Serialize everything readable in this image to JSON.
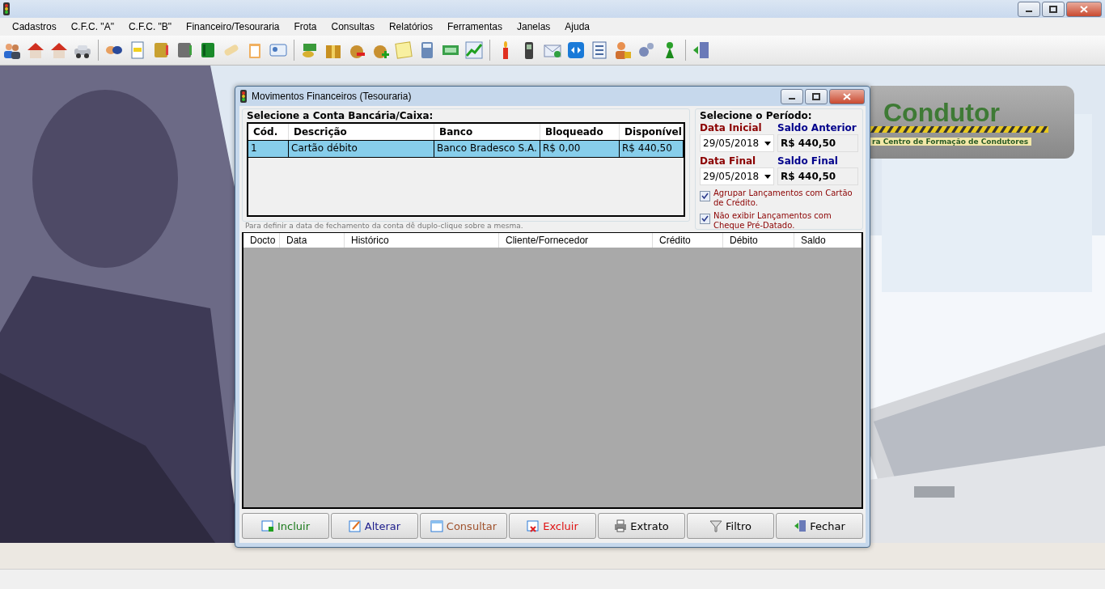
{
  "menu": [
    {
      "label": "Cadastros"
    },
    {
      "label": "C.F.C. \"A\""
    },
    {
      "label": "C.F.C. \"B\""
    },
    {
      "label": "Financeiro/Tesouraria"
    },
    {
      "label": "Frota"
    },
    {
      "label": "Consultas"
    },
    {
      "label": "Relatórios"
    },
    {
      "label": "Ferramentas"
    },
    {
      "label": "Janelas"
    },
    {
      "label": "Ajuda"
    }
  ],
  "logo": {
    "title": "Condutor",
    "subtitle": "ra Centro de Formação de Condutores"
  },
  "dialog": {
    "title": "Movimentos Financeiros (Tesouraria)",
    "accounts": {
      "title": "Selecione a Conta Bancária/Caixa:",
      "columns": [
        "Cód.",
        "Descrição",
        "Banco",
        "Bloqueado",
        "Disponível"
      ],
      "rows": [
        {
          "cells": [
            "1",
            "Cartão débito",
            "Banco Bradesco S.A.",
            "R$ 0,00",
            "R$ 440,50"
          ],
          "selected": true
        }
      ],
      "note": "Para definir a data de fechamento da conta dê duplo-clique sobre a mesma."
    },
    "period": {
      "title": "Selecione o Período:",
      "start_label": "Data Inicial",
      "start_date": "29/05/2018",
      "previous_label": "Saldo Anterior",
      "previous_balance": "R$ 440,50",
      "end_label": "Data Final",
      "end_date": "29/05/2018",
      "final_label": "Saldo Final",
      "final_balance": "R$ 440,50",
      "options": [
        {
          "label": "Agrupar Lançamentos com Cartão de Crédito.",
          "checked": true
        },
        {
          "label": "Não exibir Lançamentos com Cheque Pré-Datado.",
          "checked": true
        }
      ]
    },
    "movements": {
      "columns": [
        "Docto",
        "Data",
        "Histórico",
        "Cliente/Fornecedor",
        "Crédito",
        "Débito",
        "Saldo"
      ]
    },
    "buttons": [
      {
        "label": "Incluir",
        "kind": "add",
        "color": "#1a7a1a"
      },
      {
        "label": "Alterar",
        "kind": "edit",
        "color": "#1c1c8c"
      },
      {
        "label": "Consultar",
        "kind": "view",
        "color": "#a0522d"
      },
      {
        "label": "Excluir",
        "kind": "delete",
        "color": "#e01010"
      },
      {
        "label": "Extrato",
        "kind": "print",
        "color": "#000000"
      },
      {
        "label": "Filtro",
        "kind": "filter",
        "color": "#000000"
      },
      {
        "label": "Fechar",
        "kind": "exit",
        "color": "#000000"
      }
    ]
  }
}
